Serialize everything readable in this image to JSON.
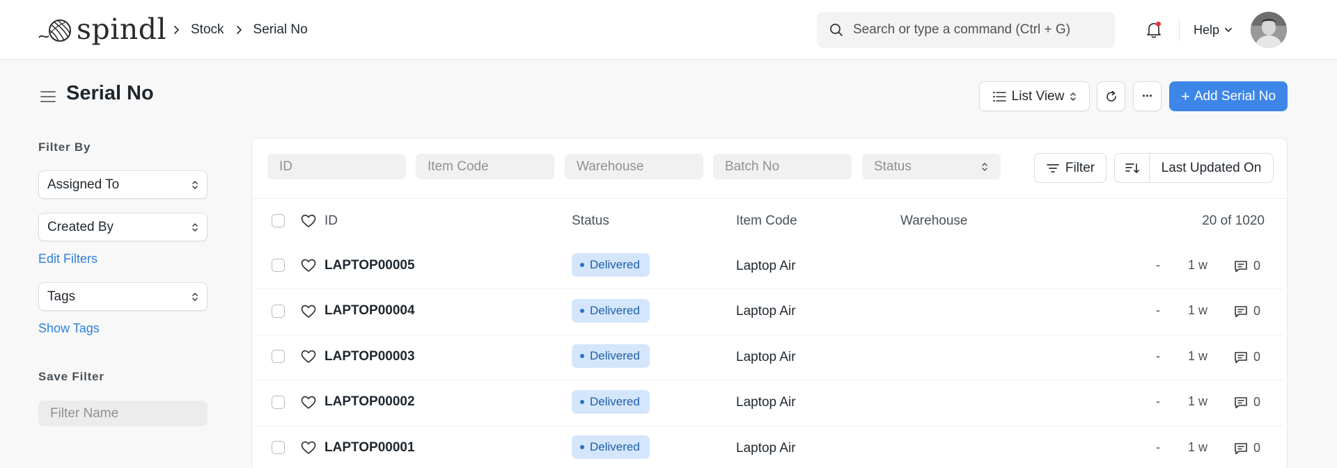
{
  "navbar": {
    "logo_text": "spindl",
    "breadcrumbs": [
      "Stock",
      "Serial No"
    ],
    "search_placeholder": "Search or type a command (Ctrl + G)",
    "help_label": "Help"
  },
  "page": {
    "title": "Serial No",
    "list_view_label": "List View",
    "add_button_label": "Add Serial No",
    "more_label": "···"
  },
  "sidebar": {
    "filter_by_label": "Filter By",
    "assigned_to": "Assigned To",
    "created_by": "Created By",
    "edit_filters": "Edit Filters",
    "tags": "Tags",
    "show_tags": "Show Tags",
    "save_filter_label": "Save Filter",
    "filter_name_placeholder": "Filter Name"
  },
  "filters": {
    "id": "ID",
    "item_code": "Item Code",
    "warehouse": "Warehouse",
    "batch_no": "Batch No",
    "status": "Status",
    "filter_button": "Filter",
    "sort_label": "Last Updated On"
  },
  "table": {
    "headers": {
      "id": "ID",
      "status": "Status",
      "item_code": "Item Code",
      "warehouse": "Warehouse",
      "count": "20 of 1020"
    },
    "rows": [
      {
        "id": "LAPTOP00005",
        "status": "Delivered",
        "item_code": "Laptop Air",
        "dash": "-",
        "modified": "1 w",
        "comments": "0"
      },
      {
        "id": "LAPTOP00004",
        "status": "Delivered",
        "item_code": "Laptop Air",
        "dash": "-",
        "modified": "1 w",
        "comments": "0"
      },
      {
        "id": "LAPTOP00003",
        "status": "Delivered",
        "item_code": "Laptop Air",
        "dash": "-",
        "modified": "1 w",
        "comments": "0"
      },
      {
        "id": "LAPTOP00002",
        "status": "Delivered",
        "item_code": "Laptop Air",
        "dash": "-",
        "modified": "1 w",
        "comments": "0"
      },
      {
        "id": "LAPTOP00001",
        "status": "Delivered",
        "item_code": "Laptop Air",
        "dash": "-",
        "modified": "1 w",
        "comments": "0"
      }
    ]
  },
  "colors": {
    "primary": "#3d86e8",
    "badge_bg": "#d4e6fb",
    "badge_text": "#1e5fa8",
    "link": "#2f80d9",
    "notification_dot": "#e03636"
  },
  "icons": [
    "yarn-logo-icon",
    "chevron-right-icon",
    "search-icon",
    "bell-icon",
    "chevron-down-icon",
    "menu-icon",
    "list-icon",
    "sort-updown-icon",
    "refresh-icon",
    "plus-icon",
    "filter-icon",
    "sort-order-icon",
    "heart-icon",
    "comment-icon"
  ]
}
